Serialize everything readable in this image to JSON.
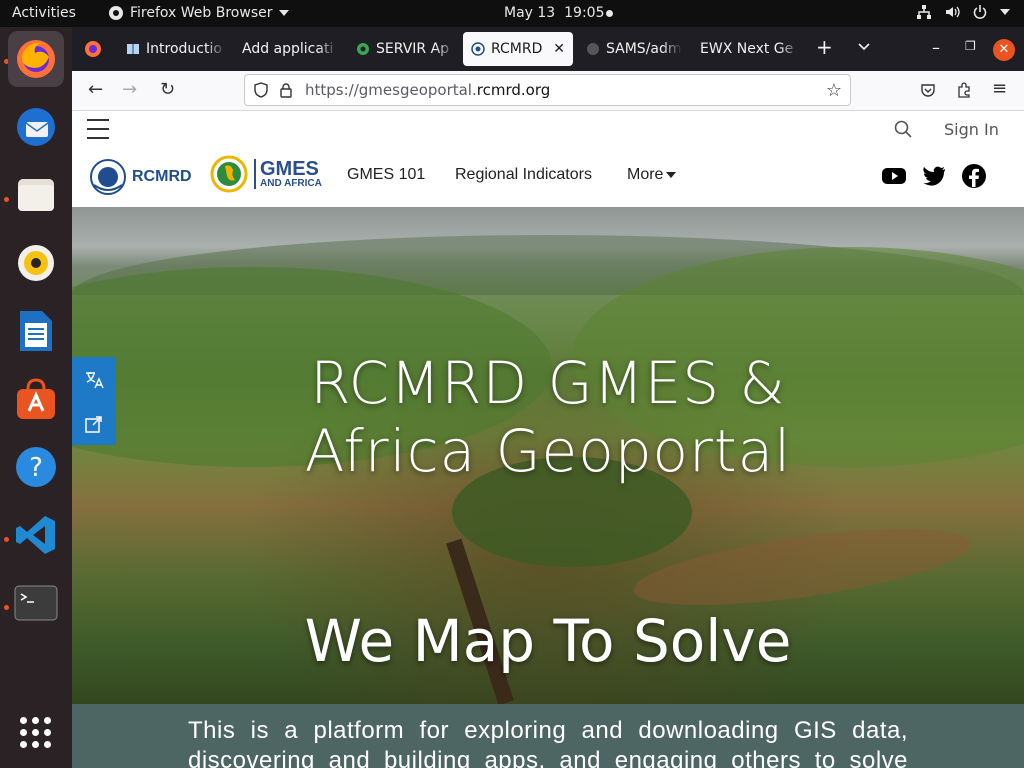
{
  "topbar": {
    "activities": "Activities",
    "app_name": "Firefox Web Browser",
    "date": "May 13",
    "time": "19:05"
  },
  "dock": {
    "items": [
      "firefox",
      "thunderbird",
      "files",
      "rhythmbox",
      "libreoffice-writer",
      "software-center",
      "help",
      "vscode",
      "terminal"
    ]
  },
  "tabs": [
    {
      "title": "Introductio",
      "favicon": "book-icon"
    },
    {
      "title": "Add applicati",
      "favicon": "none"
    },
    {
      "title": "SERVIR Ap",
      "favicon": "servir-icon"
    },
    {
      "title": "RCMRD",
      "favicon": "rcmrd-icon",
      "active": true
    },
    {
      "title": "SAMS/adm",
      "favicon": "github-icon"
    },
    {
      "title": "EWX Next Ge",
      "favicon": "none"
    }
  ],
  "url": {
    "prefix": "https://gmesgeoportal.",
    "domain": "rcmrd.org"
  },
  "site": {
    "signin": "Sign In",
    "logo_rcmrd": "RCMRD",
    "logo_gmes_big": "GMES",
    "logo_gmes_small": "AND AFRICA",
    "menu": [
      "GMES 101",
      "Regional Indicators",
      "More"
    ]
  },
  "hero": {
    "title_line1": "RCMRD GMES &",
    "title_line2": "Africa Geoportal",
    "subtitle": "We Map To Solve"
  },
  "intro": {
    "text": "This is a platform for exploring and downloading GIS data, discovering and building apps, and engaging others to solve"
  },
  "colors": {
    "accent": "#e95420",
    "tools_blue": "#1e79c7",
    "intro_bg": "#4d6663",
    "brand_blue": "#2c4f8c"
  }
}
